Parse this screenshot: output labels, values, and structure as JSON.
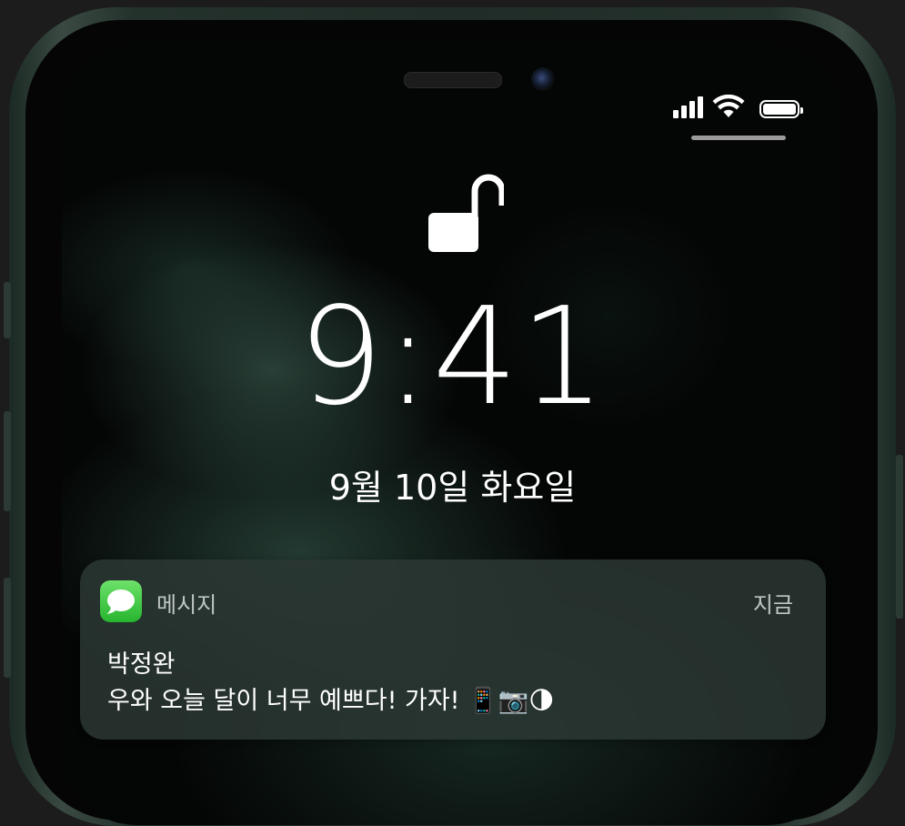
{
  "lock_screen": {
    "time": "9:41",
    "date": "9월 10일 화요일"
  },
  "notification": {
    "app_name": "메시지",
    "time": "지금",
    "sender": "박정완",
    "message": "우와 오늘 달이 너무 예쁘다! 가자! 📱📷🌗"
  },
  "icons": {
    "lock": "unlocked-padlock-icon",
    "signal": "cellular-signal-icon",
    "wifi": "wifi-icon",
    "battery": "battery-icon",
    "app": "messages-app-icon"
  },
  "colors": {
    "messages_green": "#34C759",
    "frame": "#2c3a34"
  }
}
